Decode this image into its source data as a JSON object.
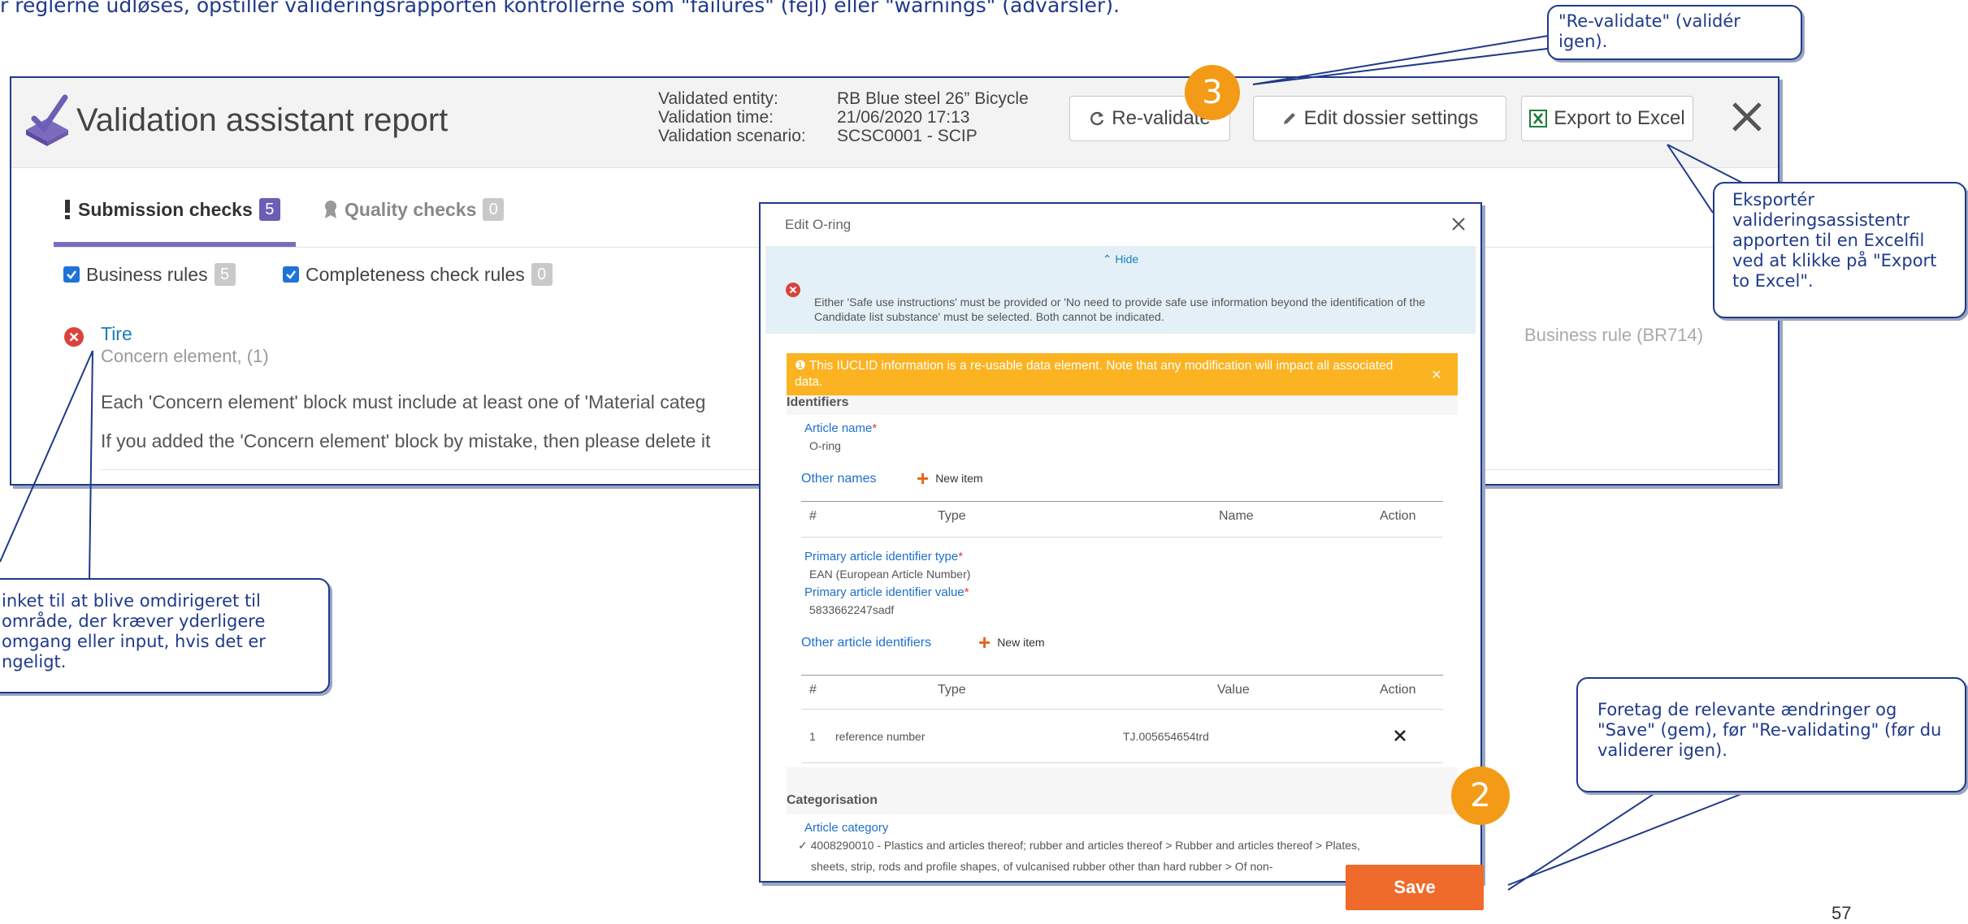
{
  "top_text": "r reglerne udløses, opstiller valideringsrapporten kontrollerne som \"failures\" (fejl) eller \"warnings\" (advarsler).",
  "report": {
    "title": "Validation assistant report",
    "meta": [
      {
        "key": "Validated entity:",
        "value": "RB Blue steel 26” Bicycle"
      },
      {
        "key": "Validation time:",
        "value": "21/06/2020 17:13"
      },
      {
        "key": "Validation scenario:",
        "value": "SCSC0001 - SCIP"
      }
    ],
    "buttons": {
      "revalidate": "Re-validate",
      "edit_dossier": "Edit dossier settings",
      "export": "Export to Excel"
    },
    "tabs": {
      "submission": {
        "label": "Submission checks",
        "count": "5"
      },
      "quality": {
        "label": "Quality checks",
        "count": "0"
      }
    },
    "filters": {
      "business": {
        "label": "Business rules",
        "count": "5"
      },
      "completeness": {
        "label": "Completeness check rules",
        "count": "0"
      }
    },
    "issue": {
      "title": "Tire",
      "subtitle": "Concern element, (1)",
      "rule": "Business rule (BR714)",
      "desc1": "Each 'Concern element' block must include at least one of 'Material categ",
      "desc2": "If you added the 'Concern element' block by mistake, then please delete it"
    }
  },
  "dialog": {
    "title": "Edit O-ring",
    "hide": "Hide",
    "error": "Either 'Safe use instructions' must be provided or 'No need to provide safe use information beyond the identification of the Candidate list substance' must be selected. Both cannot be indicated.",
    "warning": "This IUCLID information is a re-usable data element. Note that any modification will impact all associated data.",
    "identifiers": {
      "title": "Identifiers",
      "article_name_label": "Article name",
      "article_name_value": "O-ring",
      "other_names": "Other names",
      "new_item": "New item",
      "table1_headers": [
        "#",
        "Type",
        "Name",
        "Action"
      ],
      "pid_type_label": "Primary article identifier type",
      "pid_type_value": "EAN (European Article Number)",
      "pid_value_label": "Primary article identifier value",
      "pid_value_value": "5833662247sadf",
      "other_ids": "Other article identifiers",
      "table2_headers": [
        "#",
        "Type",
        "Value",
        "Action"
      ],
      "table2_rows": [
        {
          "num": "1",
          "type": "reference number",
          "value": "TJ.005654654trd"
        }
      ]
    },
    "categorisation": {
      "title": "Categorisation",
      "article_category_label": "Article category",
      "article_category_line1": "4008290010 - Plastics and articles thereof; rubber and articles thereof > Rubber and articles thereof > Plates,",
      "article_category_line2": "sheets, strip, rods and profile shapes, of vulcanised rubber other than hard rubber > Of non-"
    },
    "save": "Save"
  },
  "callouts": {
    "revalidate": "\"Re-validate\" (validér igen).",
    "export": "Eksportér valideringsassistentr apporten til en Excelfil ved at klikke på \"Export to Excel\".",
    "link": "inket til at blive omdirigeret til område, der kræver yderligere omgang eller input, hvis det er ngeligt.",
    "save": "Foretag de relevante ændringer og \"Save\" (gem), før \"Re-validating\" (før du validerer igen)."
  },
  "steps": {
    "three": "3",
    "two": "2"
  },
  "page_number": "57",
  "colors": {
    "accent_purple": "#6c5eb5",
    "callout_blue": "#1f3a8a",
    "step_orange": "#f39b16",
    "save_orange": "#ef6b2c",
    "warning_yellow": "#fbb321",
    "link_blue": "#1e6fcc"
  }
}
